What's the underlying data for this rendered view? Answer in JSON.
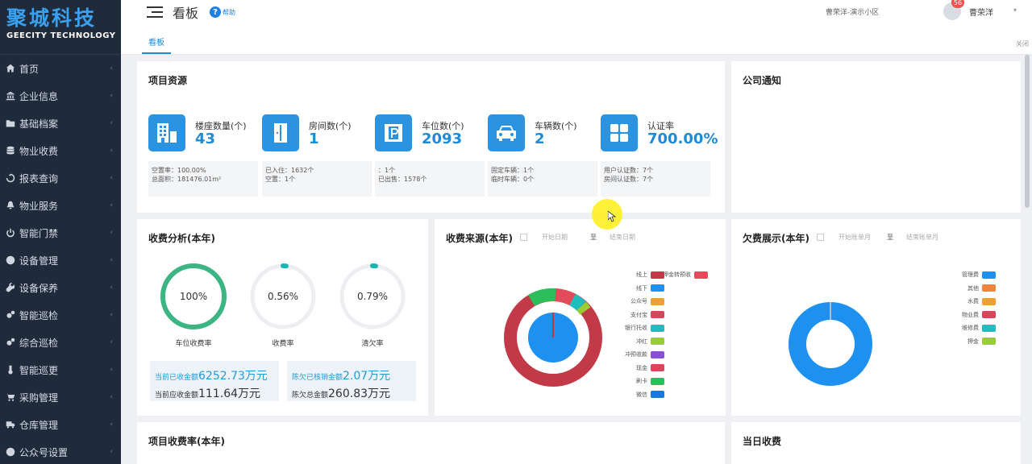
{
  "brand": {
    "name_cn": "聚城科技",
    "name_en": "GEECITY TECHNOLOGY"
  },
  "sidebar": {
    "items": [
      {
        "label": "首页",
        "icon": "home-icon"
      },
      {
        "label": "企业信息",
        "icon": "bank-icon"
      },
      {
        "label": "基础档案",
        "icon": "folder-icon"
      },
      {
        "label": "物业收费",
        "icon": "database-icon"
      },
      {
        "label": "报表查询",
        "icon": "recycle-icon"
      },
      {
        "label": "物业服务",
        "icon": "bell-icon"
      },
      {
        "label": "智能门禁",
        "icon": "power-icon"
      },
      {
        "label": "设备管理",
        "icon": "globe-icon"
      },
      {
        "label": "设备保养",
        "icon": "wrench-icon"
      },
      {
        "label": "智能巡检",
        "icon": "gears-icon"
      },
      {
        "label": "综合巡检",
        "icon": "gears-icon"
      },
      {
        "label": "智能巡更",
        "icon": "thermometer-icon"
      },
      {
        "label": "采购管理",
        "icon": "cart-icon"
      },
      {
        "label": "仓库管理",
        "icon": "truck-icon"
      },
      {
        "label": "公众号设置",
        "icon": "globe-icon"
      }
    ]
  },
  "header": {
    "title": "看板",
    "help_label": "帮助",
    "community": "曹荣洋-演示小区",
    "username": "曹荣洋",
    "notification_count": "56"
  },
  "tabs": {
    "active": "看板",
    "close_label": "关闭"
  },
  "resources": {
    "title": "项目资源",
    "items": [
      {
        "label": "楼座数量(个)",
        "value": "43",
        "icon": "building-icon",
        "detail1": "空置率：100.00%",
        "detail2": "总面积：181476.01m²"
      },
      {
        "label": "房间数(个)",
        "value": "1",
        "icon": "door-icon",
        "detail1": "已入住：1632个",
        "detail2": "空置：1个"
      },
      {
        "label": "车位数(个)",
        "value": "2093",
        "icon": "parking-icon",
        "detail1": "：1个",
        "detail2": "已出售：1578个"
      },
      {
        "label": "车辆数(个)",
        "value": "2",
        "icon": "car-icon",
        "detail1": "固定车辆：1个",
        "detail2": "临时车辆：0个"
      },
      {
        "label": "认证率",
        "value": "700.00%",
        "icon": "grid-icon",
        "detail1": "用户认证数：7个",
        "detail2": "房间认证数：7个"
      }
    ]
  },
  "notice": {
    "title": "公司通知"
  },
  "fee_analysis": {
    "title": "收费分析(本年)",
    "gauges": [
      {
        "label": "车位收费率",
        "text": "100%",
        "fraction": 1.0,
        "color": "#3db483"
      },
      {
        "label": "收费率",
        "text": "0.56%",
        "fraction": 0.0056,
        "color": "#1bb5b0"
      },
      {
        "label": "清欠率",
        "text": "0.79%",
        "fraction": 0.0079,
        "color": "#1bb5b0"
      }
    ],
    "summary": [
      {
        "line1_label": "当前已收金额",
        "line1_value": "6252.73万元",
        "line2_label": "当前应收金额",
        "line2_value": "111.64万元"
      },
      {
        "line1_label": "陈欠已核销金额",
        "line1_value": "2.07万元",
        "line2_label": "陈欠总金额",
        "line2_value": "260.83万元"
      }
    ]
  },
  "fee_source": {
    "title": "收费来源(本年)",
    "start_placeholder": "开始日期",
    "separator": "至",
    "end_placeholder": "结束日期",
    "legend_right": {
      "label": "押金转预收",
      "color": "#e34b5a"
    },
    "legend": [
      {
        "label": "线上",
        "color": "#c23a48"
      },
      {
        "label": "线下",
        "color": "#1e90f0"
      },
      {
        "label": "公众号",
        "color": "#f0a030"
      },
      {
        "label": "支付宝",
        "color": "#d9455a"
      },
      {
        "label": "银行托收",
        "color": "#1fbdbd"
      },
      {
        "label": "冲红",
        "color": "#9acd32"
      },
      {
        "label": "冲预收款",
        "color": "#8a4fd8"
      },
      {
        "label": "现金",
        "color": "#d9455a"
      },
      {
        "label": "刷卡",
        "color": "#2dbd5a"
      },
      {
        "label": "微信",
        "color": "#1a78d6"
      }
    ]
  },
  "arrears": {
    "title": "欠费展示(本年)",
    "start_placeholder": "开始账单月",
    "separator": "至",
    "end_placeholder": "结束账单月",
    "legend": [
      {
        "label": "管理费",
        "color": "#1e90f0"
      },
      {
        "label": "其他",
        "color": "#f0843c"
      },
      {
        "label": "水费",
        "color": "#f0a030"
      },
      {
        "label": "物业费",
        "color": "#d9455a"
      },
      {
        "label": "维修费",
        "color": "#1fbdbd"
      },
      {
        "label": "押金",
        "color": "#9acd32"
      }
    ]
  },
  "bottom": {
    "project_rate_title": "项目收费率(本年)",
    "daily_title": "当日收费"
  }
}
